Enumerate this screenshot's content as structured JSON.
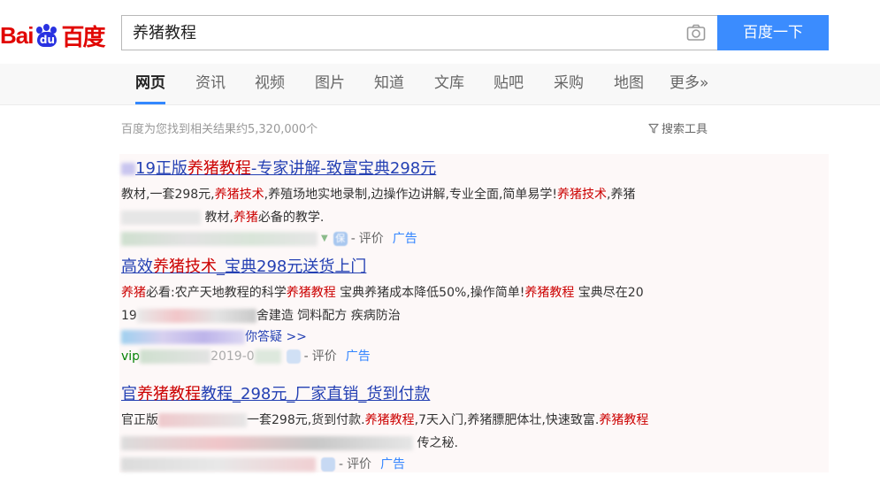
{
  "logo": {
    "prefix": "Bai",
    "paw": "du",
    "cn": "百度"
  },
  "search": {
    "value": "养猪教程",
    "button": "百度一下"
  },
  "tabs": [
    "网页",
    "资讯",
    "视频",
    "图片",
    "知道",
    "文库",
    "贴吧",
    "采购",
    "地图",
    "更多»"
  ],
  "result_count": "百度为您找到相关结果约5,320,000个",
  "search_tools": "搜索工具",
  "ads": [
    {
      "title": [
        {
          "t": "19正版",
          "hl": false
        },
        {
          "t": "养猪教程",
          "hl": true
        },
        {
          "t": "-专家讲解-致富宝典298元",
          "hl": false
        }
      ],
      "desc_line1": [
        {
          "t": "教材,一套298元,",
          "hl": false
        },
        {
          "t": "养猪技术",
          "hl": true
        },
        {
          "t": ",养殖场地实地录制,边操作边讲解,专业全面,简单易学!",
          "hl": false
        },
        {
          "t": "养猪技术",
          "hl": true
        },
        {
          "t": ",养猪",
          "hl": false
        }
      ],
      "desc_line2": [
        {
          "t": "教材,",
          "hl": false
        },
        {
          "t": "养猪",
          "hl": true
        },
        {
          "t": "必备的教学.",
          "hl": false
        }
      ],
      "rate": "评价",
      "ad_tag": "广告"
    },
    {
      "title": [
        {
          "t": "高效",
          "hl": false
        },
        {
          "t": "养猪技术",
          "hl": true
        },
        {
          "t": "_宝典298元送货上门",
          "hl": false
        }
      ],
      "desc_line1": [
        {
          "t": "养猪",
          "hl": true
        },
        {
          "t": "必看:农产天地教程的科学",
          "hl": false
        },
        {
          "t": "养猪教程",
          "hl": true
        },
        {
          "t": " 宝典养猪成本降低50%,操作简单!",
          "hl": false
        },
        {
          "t": "养猪教程",
          "hl": true
        },
        {
          "t": " 宝典尽在20",
          "hl": false
        }
      ],
      "desc_line2": [
        {
          "t": "19",
          "hl": false
        },
        {
          "t": "舍建造 饲料配方 疾病防治",
          "hl": false
        }
      ],
      "link": "你答疑 >>",
      "url_prefix": "vip",
      "url_year": "2019-0",
      "rate": "评价",
      "ad_tag": "广告"
    },
    {
      "title": [
        {
          "t": "官",
          "hl": false
        },
        {
          "t": "养猪教程",
          "hl": true
        },
        {
          "t": "教程_298元_厂家直销_货到付款",
          "hl": false
        }
      ],
      "desc_line1": [
        {
          "t": "官正版",
          "hl": false
        },
        {
          "t": "一套298元,货到付款.",
          "hl": false
        },
        {
          "t": "养猪教程",
          "hl": true
        },
        {
          "t": ",7天入门,养猪膘肥体壮,快速致富.",
          "hl": false
        },
        {
          "t": "养猪教程",
          "hl": true
        }
      ],
      "desc_line2": [
        {
          "t": "传之秘.",
          "hl": false
        }
      ],
      "rate": "评价",
      "ad_tag": "广告"
    }
  ],
  "colors": {
    "brand_red": "#e10602",
    "brand_blue": "#2932e1",
    "button": "#3b8cfe",
    "link": "#2440b3",
    "highlight": "#cc0000"
  }
}
